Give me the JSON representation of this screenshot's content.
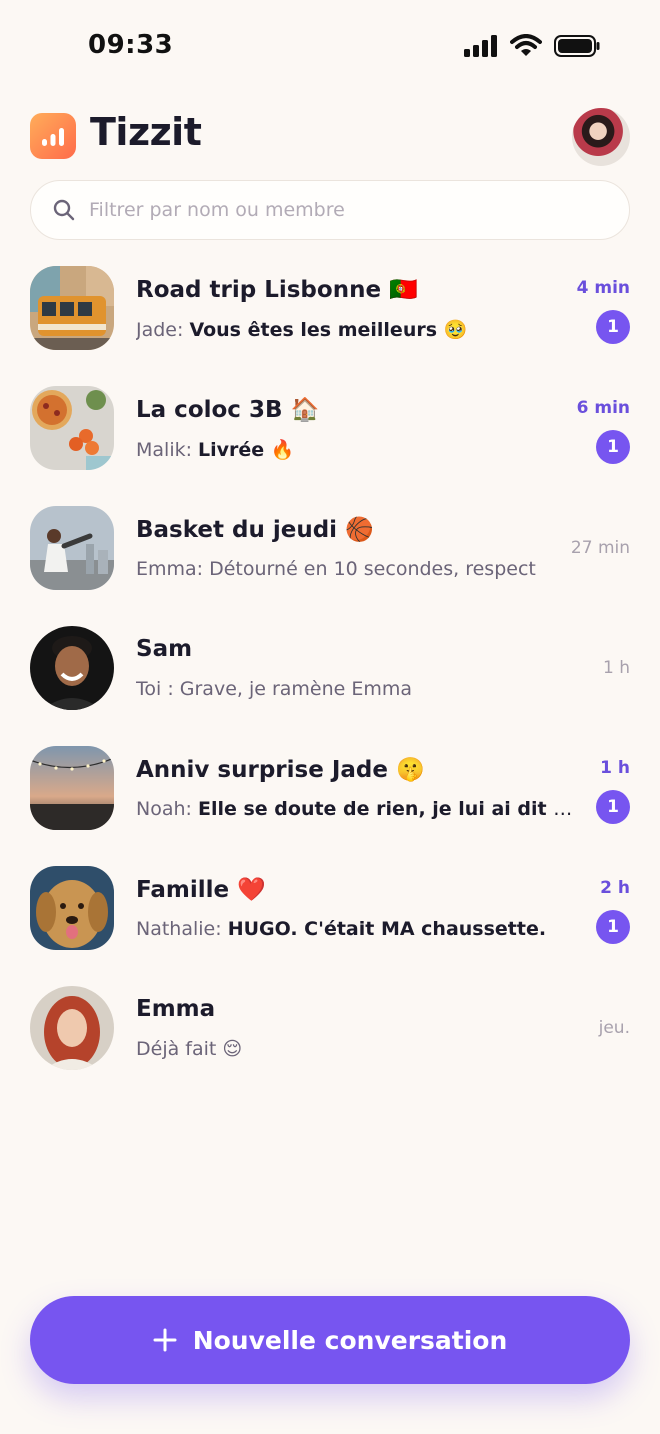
{
  "status_bar": {
    "time": "09:33"
  },
  "app": {
    "title": "Tizzit",
    "brand_gradient": [
      "#ffad5a",
      "#ff6b4a"
    ],
    "accent": "#7755f0"
  },
  "search": {
    "placeholder": "Filtrer par nom ou membre"
  },
  "conversations": [
    {
      "name": "Road trip Lisbonne 🇵🇹",
      "sender": "Jade: ",
      "message": "Vous êtes les meilleurs 🥹",
      "time": "4 min",
      "unread": "1",
      "avatar": "tram-photo"
    },
    {
      "name": "La coloc 3B 🏠",
      "sender": "Malik: ",
      "message": "Livrée 🔥",
      "time": "6 min",
      "unread": "1",
      "avatar": "pizza-photo"
    },
    {
      "name": "Basket du jeudi 🏀",
      "sender": "Emma: ",
      "message": "Détourné en 10 secondes, respect",
      "time": "27 min",
      "avatar": "basketball-photo"
    },
    {
      "name": "Sam",
      "sender": "Toi : ",
      "message": "Grave, je ramène Emma",
      "time": "1 h",
      "avatar": "sam-photo"
    },
    {
      "name": "Anniv surprise Jade 🤫",
      "sender": "Noah: ",
      "message": "Elle se doute de rien, je lui ai dit qu'on",
      "time": "1 h",
      "unread": "1",
      "avatar": "terrace-photo"
    },
    {
      "name": "Famille ❤️",
      "sender": "Nathalie: ",
      "message": "HUGO. C'était MA chaussette.",
      "time": "2 h",
      "unread": "1",
      "avatar": "dog-photo"
    },
    {
      "name": "Emma",
      "sender": "",
      "message": "Déjà fait 😌",
      "time": "jeu.",
      "avatar": "emma-photo"
    }
  ],
  "actions": {
    "new_conversation": "Nouvelle conversation"
  }
}
